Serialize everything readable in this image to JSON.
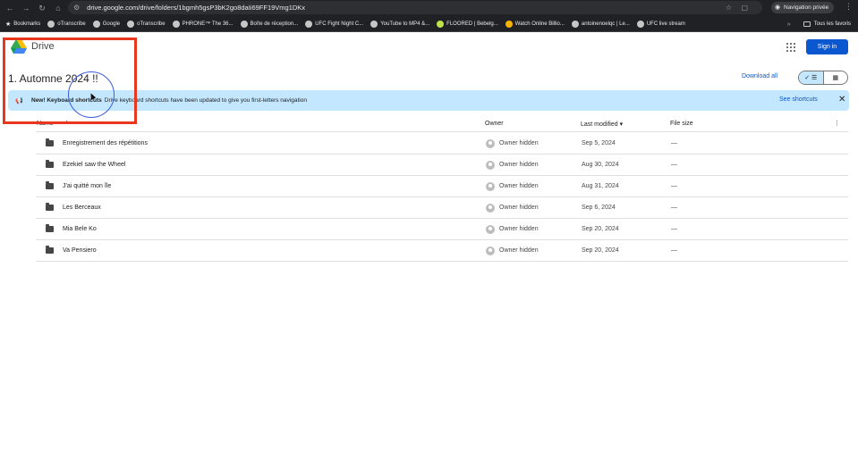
{
  "browser": {
    "url": "drive.google.com/drive/folders/1bgmh5gsP3bK2go8daIi69FF19Vmg1DKx",
    "private_label": "Navigation privée",
    "bookmarks": [
      "Bookmarks",
      "oTranscribe",
      "Google",
      "oTranscribe",
      "PHRONE™ The 36...",
      "Boîte de réception...",
      "UFC Fight Night C...",
      "YouTube to MP4 &...",
      "FLOORED | Bebelg...",
      "Watch Online Billio...",
      "antoinenoelqc | Le...",
      "UFC live stream"
    ],
    "all_bookmarks": "Tous les favoris"
  },
  "header": {
    "app_name": "Drive",
    "sign_in": "Sign in",
    "brand_colors": [
      "#4285f4",
      "#ea4335",
      "#fbbc04",
      "#34a853"
    ]
  },
  "folder": {
    "title": "1. Automne 2024 !!",
    "download_all": "Download all"
  },
  "banner": {
    "bold": "New! Keyboard shortcuts",
    "message": "Drive keyboard shortcuts have been updated to give you first-letters navigation",
    "see_shortcuts": "See shortcuts"
  },
  "table": {
    "headers": {
      "name": "Name",
      "owner": "Owner",
      "last_modified": "Last modified",
      "file_size": "File size"
    },
    "rows": [
      {
        "name": "Enregistrement des répétitions",
        "owner": "Owner hidden",
        "modified": "Sep 5, 2024",
        "size": "—"
      },
      {
        "name": "Ezekiel saw the Wheel",
        "owner": "Owner hidden",
        "modified": "Aug 30, 2024",
        "size": "—"
      },
      {
        "name": "J'ai quitté mon île",
        "owner": "Owner hidden",
        "modified": "Aug 31, 2024",
        "size": "—"
      },
      {
        "name": "Les Berceaux",
        "owner": "Owner hidden",
        "modified": "Sep 6, 2024",
        "size": "—"
      },
      {
        "name": "Mia Bele Ko",
        "owner": "Owner hidden",
        "modified": "Sep 20, 2024",
        "size": "—"
      },
      {
        "name": "Va Pensiero",
        "owner": "Owner hidden",
        "modified": "Sep 20, 2024",
        "size": "—"
      }
    ]
  }
}
